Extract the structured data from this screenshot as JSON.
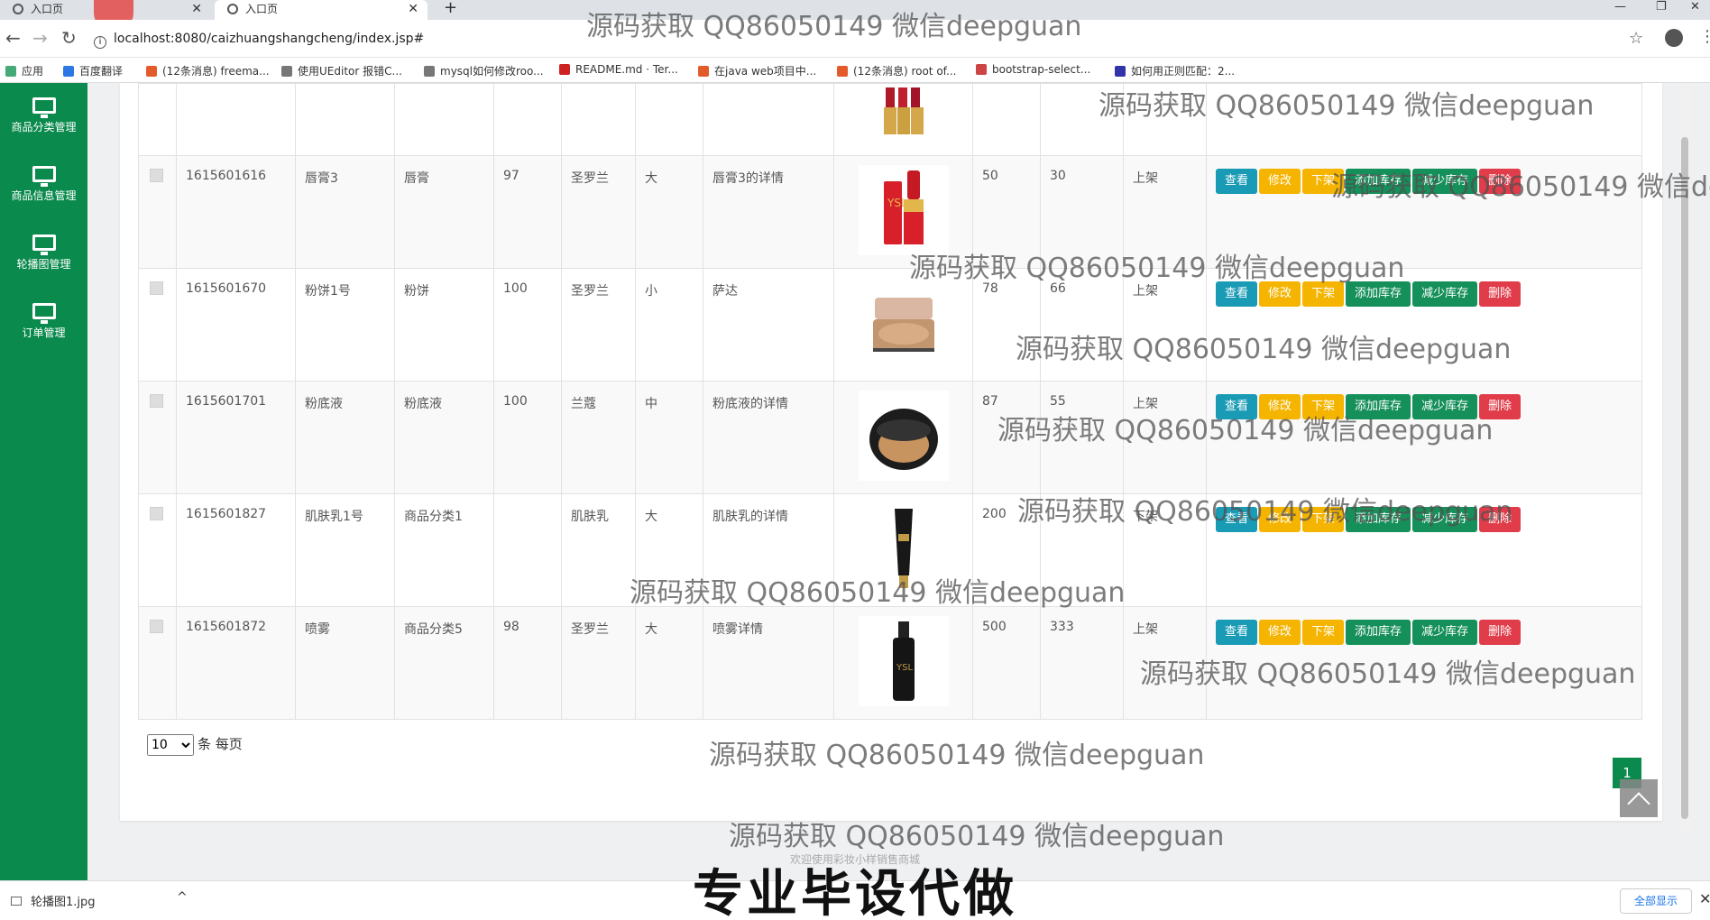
{
  "browser": {
    "tabs": [
      {
        "label": "入口页"
      },
      {
        "label": "入口页"
      }
    ],
    "url": "localhost:8080/caizhuangshangcheng/index.jsp#",
    "bookmarks": [
      "应用",
      "百度翻译",
      "(12条消息) freema...",
      "使用UEditor 报错C...",
      "mysql如何修改roo...",
      "README.md · Ter...",
      "在java web项目中...",
      "(12条消息) root of...",
      "bootstrap-select...",
      "如何用正则匹配：2..."
    ]
  },
  "sidebar": {
    "items": [
      {
        "label": "商品分类管理",
        "icon": "monitor-icon"
      },
      {
        "label": "商品信息管理",
        "icon": "monitor-icon"
      },
      {
        "label": "轮播图管理",
        "icon": "monitor-icon"
      },
      {
        "label": "订单管理",
        "icon": "monitor-icon"
      }
    ]
  },
  "actions": {
    "view": "查看",
    "edit": "修改",
    "off_shelf": "下架",
    "add_stock": "添加库存",
    "reduce_stock": "减少库存",
    "delete": "删除"
  },
  "rows": [
    {
      "id": "",
      "name": "",
      "category": "",
      "price": "",
      "brand": "",
      "size": "",
      "detail": "",
      "v1": "",
      "v2": "",
      "status": "",
      "image": "lipstick-set",
      "partial": true
    },
    {
      "id": "1615601616",
      "name": "唇膏3",
      "category": "唇膏",
      "price": "97",
      "brand": "圣罗兰",
      "size": "大",
      "detail": "唇膏3的详情",
      "v1": "50",
      "v2": "30",
      "status": "上架",
      "image": "lipstick"
    },
    {
      "id": "1615601670",
      "name": "粉饼1号",
      "category": "粉饼",
      "price": "100",
      "brand": "圣罗兰",
      "size": "小",
      "detail": "萨达",
      "v1": "78",
      "v2": "66",
      "status": "上架",
      "image": "compact"
    },
    {
      "id": "1615601701",
      "name": "粉底液",
      "category": "粉底液",
      "price": "100",
      "brand": "兰蔻",
      "size": "中",
      "detail": "粉底液的详情",
      "v1": "87",
      "v2": "55",
      "status": "上架",
      "image": "cushion"
    },
    {
      "id": "1615601827",
      "name": "肌肤乳1号",
      "category": "商品分类1",
      "price": "",
      "brand": "肌肤乳",
      "size": "大",
      "detail": "肌肤乳的详情",
      "v1": "200",
      "v2": "",
      "status": "下架",
      "image": "tube"
    },
    {
      "id": "1615601872",
      "name": "喷雾",
      "category": "商品分类5",
      "price": "98",
      "brand": "圣罗兰",
      "size": "大",
      "detail": "喷雾详情",
      "v1": "500",
      "v2": "333",
      "status": "上架",
      "image": "spray"
    }
  ],
  "pager": {
    "page_size": "10",
    "per_page_label": "条 每页",
    "current_page": "1"
  },
  "footer": "欢迎使用彩妆小样销售商城",
  "downloads": {
    "file": "轮播图1.jpg",
    "show_all": "全部显示"
  },
  "caption": "专业毕设代做",
  "watermark": "源码获取 QQ86050149 微信deepguan"
}
